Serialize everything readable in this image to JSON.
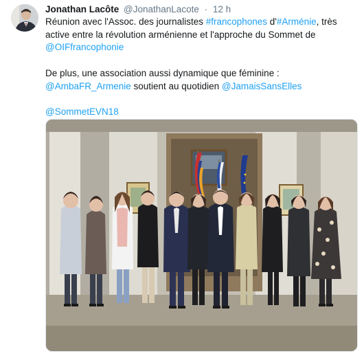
{
  "tweet": {
    "author_name": "Jonathan Lacôte",
    "author_handle": "@JonathanLacote",
    "separator": "·",
    "time": "12 h",
    "text": {
      "p1_a": "Réunion avec l'Assoc. des journalistes ",
      "p1_hashtag1": "#francophones",
      "p1_b": " d'",
      "p1_hashtag2": "#Arménie",
      "p1_c": ", très active entre la révolution arménienne et l'approche du Sommet de ",
      "p1_mention": "@OIFfrancophonie",
      "p2_a": "De plus, une association aussi dynamique que féminine : ",
      "p2_mention1": "@AmbaFR_Armenie",
      "p2_b": " soutient au quotidien ",
      "p2_mention2": "@JamaisSansElles",
      "p3_mention": "@SommetEVN18"
    },
    "photo": {
      "subject": "group photo of eleven people posing in a hall with flags",
      "flags": [
        "Armenia",
        "France",
        "European Union"
      ]
    }
  },
  "colors": {
    "link": "#1da1f2",
    "text": "#14171a",
    "secondary": "#657786",
    "border": "#e1e8ed"
  }
}
